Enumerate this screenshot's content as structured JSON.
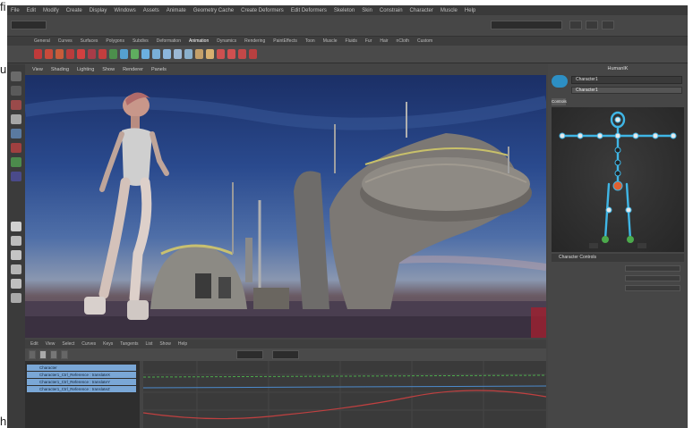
{
  "menubar": {
    "items": [
      "File",
      "Edit",
      "Modify",
      "Create",
      "Display",
      "Windows",
      "Assets",
      "Animate",
      "Geometry Cache",
      "Create Deformers",
      "Edit Deformers",
      "Skeleton",
      "Skin",
      "Constrain",
      "Character",
      "Muscle",
      "Help"
    ]
  },
  "shelf": {
    "tabs": [
      "General",
      "Curves",
      "Surfaces",
      "Polygons",
      "Subdivs",
      "Deformation",
      "Animation",
      "Dynamics",
      "Rendering",
      "PaintEffects",
      "Toon",
      "Muscle",
      "Fluids",
      "Fur",
      "Hair",
      "nCloth",
      "Custom"
    ],
    "active_tab": "Animation"
  },
  "viewport": {
    "menu": [
      "View",
      "Shading",
      "Lighting",
      "Show",
      "Renderer",
      "Panels"
    ]
  },
  "timeline": {
    "menu": [
      "Edit",
      "View",
      "Select",
      "Curves",
      "Keys",
      "Tangents",
      "List",
      "Show",
      "Help"
    ]
  },
  "outliner": {
    "rows": [
      "Character",
      "Character1_Ctrl_Reference : translateX",
      "Character1_Ctrl_Reference : translateY",
      "Character1_Ctrl_Reference : translateZ"
    ]
  },
  "right_panel": {
    "title": "HumanIK",
    "character": "Character1",
    "source": "Character1",
    "tab": "Controls",
    "section": "Character Controls"
  },
  "colors": {
    "app_bg": "#444444",
    "sky_top": "#1b2f66",
    "selection": "#7aa7d6",
    "hik_bone": "#3fb6e6",
    "curve_red": "#c04040"
  }
}
